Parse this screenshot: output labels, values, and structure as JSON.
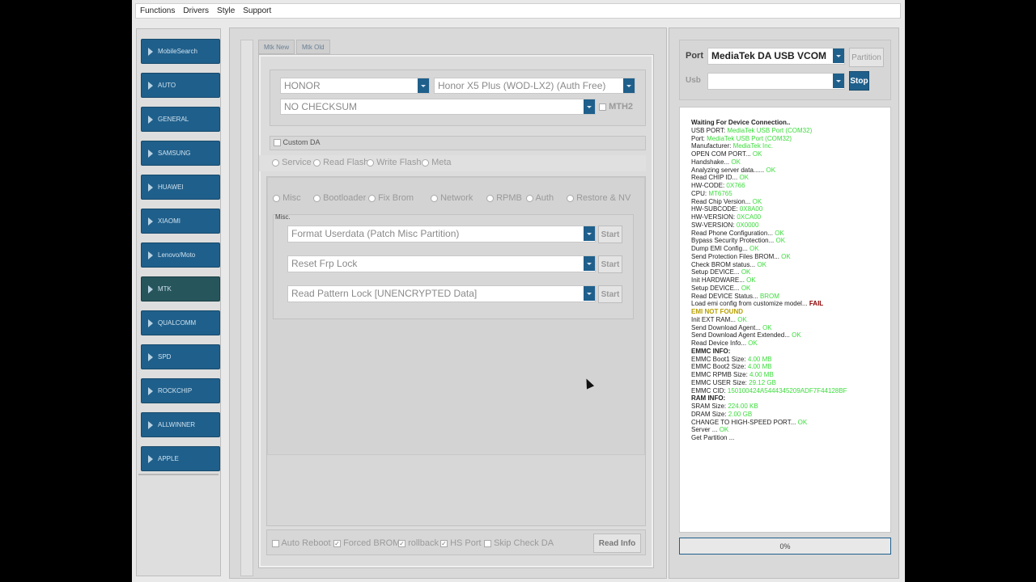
{
  "menu": [
    "Functions",
    "Drivers",
    "Style",
    "Support"
  ],
  "sidebar": {
    "items": [
      {
        "label": "MobileSearch"
      },
      {
        "label": "AUTO"
      },
      {
        "label": "GENERAL"
      },
      {
        "label": "SAMSUNG"
      },
      {
        "label": "HUAWEI"
      },
      {
        "label": "XIAOMI"
      },
      {
        "label": "Lenovo/Moto"
      },
      {
        "label": "MTK",
        "active": true
      },
      {
        "label": "QUALCOMM"
      },
      {
        "label": "SPD"
      },
      {
        "label": "ROCKCHIP"
      },
      {
        "label": "ALLWINNER"
      },
      {
        "label": "APPLE"
      }
    ]
  },
  "tabs": [
    "Mtk New",
    "Mtk Old"
  ],
  "device": {
    "brand": "HONOR",
    "model": "Honor X5 Plus (WOD-LX2) (Auth Free)",
    "checksum": "NO CHECKSUM",
    "mth2_label": "MTH2",
    "custom_da_label": "Custom DA"
  },
  "modes": [
    "Service",
    "Read Flash",
    "Write Flash",
    "Meta"
  ],
  "service_tabs": [
    "Misc",
    "Bootloader",
    "Fix Brom",
    "Network",
    "RPMB",
    "Auth",
    "Restore & NV"
  ],
  "misc": {
    "group_label": "Misc.",
    "ops": [
      {
        "label": "Format Userdata (Patch Misc Partition)",
        "button": "Start"
      },
      {
        "label": "Reset Frp Lock",
        "button": "Start"
      },
      {
        "label": "Read Pattern Lock [UNENCRYPTED Data]",
        "button": "Start"
      }
    ]
  },
  "bottom_options": [
    {
      "label": "Auto Reboot",
      "checked": false
    },
    {
      "label": "Forced BROM",
      "checked": true
    },
    {
      "label": "rollback",
      "checked": true
    },
    {
      "label": "HS Port",
      "checked": true
    },
    {
      "label": "Skip Check DA",
      "checked": false
    }
  ],
  "read_info_button": "Read Info",
  "port": {
    "label": "Port",
    "value": "MediaTek DA USB VCOM",
    "partition_button": "Partition",
    "usb_label": "Usb",
    "usb_value": "",
    "stop_button": "Stop"
  },
  "log": [
    {
      "k": "Waiting For Device Connection..",
      "v": "",
      "s": "hdr"
    },
    {
      "k": "USB PORT: ",
      "v": "MediaTek USB Port (COM32)",
      "s": "ok"
    },
    {
      "k": "Port: ",
      "v": "MediaTek USB Port (COM32)",
      "s": "ok"
    },
    {
      "k": "Manufacturer: ",
      "v": "MediaTek Inc.",
      "s": "ok"
    },
    {
      "k": "OPEN COM PORT... ",
      "v": "OK",
      "s": "ok"
    },
    {
      "k": "Handshake... ",
      "v": "OK",
      "s": "ok"
    },
    {
      "k": "Analyzing server data...... ",
      "v": "OK",
      "s": "ok"
    },
    {
      "k": "Read CHIP ID... ",
      "v": "OK",
      "s": "ok"
    },
    {
      "k": "HW-CODE: ",
      "v": "0X766",
      "s": "ok"
    },
    {
      "k": "CPU: ",
      "v": "MT6765",
      "s": "ok"
    },
    {
      "k": "Read Chip Version... ",
      "v": "OK",
      "s": "ok"
    },
    {
      "k": "HW-SUBCODE: ",
      "v": "0X8A00",
      "s": "ok"
    },
    {
      "k": "HW-VERSION: ",
      "v": "0XCA00",
      "s": "ok"
    },
    {
      "k": "SW-VERSION: ",
      "v": "0X0000",
      "s": "ok"
    },
    {
      "k": "Read Phone Configuration... ",
      "v": "OK",
      "s": "ok"
    },
    {
      "k": "Bypass Security Protection... ",
      "v": "OK",
      "s": "ok"
    },
    {
      "k": "Dump EMI Config... ",
      "v": "OK",
      "s": "ok"
    },
    {
      "k": "Send Protection Files BROM... ",
      "v": "OK",
      "s": "ok"
    },
    {
      "k": "Check BROM status... ",
      "v": "OK",
      "s": "ok"
    },
    {
      "k": "Setup DEVICE... ",
      "v": "OK",
      "s": "ok"
    },
    {
      "k": "Init HARDWARE... ",
      "v": "OK",
      "s": "ok"
    },
    {
      "k": "Setup DEVICE... ",
      "v": "OK",
      "s": "ok"
    },
    {
      "k": "Read DEVICE Status... ",
      "v": "BROM",
      "s": "ok"
    },
    {
      "k": "Load emi config from customize model... ",
      "v": "FAIL",
      "s": "fail"
    },
    {
      "k": "  EMI NOT FOUND",
      "v": "",
      "s": "warn"
    },
    {
      "k": "Init EXT RAM... ",
      "v": "OK",
      "s": "ok"
    },
    {
      "k": "Send Download Agent... ",
      "v": "OK",
      "s": "ok"
    },
    {
      "k": "Send Download Agent Extended... ",
      "v": "OK",
      "s": "ok"
    },
    {
      "k": "Read Device Info... ",
      "v": "OK",
      "s": "ok"
    },
    {
      "k": "EMMC INFO:",
      "v": "",
      "s": "hdr"
    },
    {
      "k": "EMMC Boot1 Size: ",
      "v": "4.00 MB",
      "s": "ok"
    },
    {
      "k": "EMMC Boot2 Size: ",
      "v": "4.00 MB",
      "s": "ok"
    },
    {
      "k": "EMMC RPMB Size: ",
      "v": "4.00 MB",
      "s": "ok"
    },
    {
      "k": "EMMC USER Size: ",
      "v": "29.12 GB",
      "s": "ok"
    },
    {
      "k": "EMMC CID: ",
      "v": "150100424A5444345209ADF7F44128BF",
      "s": "ok"
    },
    {
      "k": "RAM INFO:",
      "v": "",
      "s": "hdr"
    },
    {
      "k": "SRAM Size: ",
      "v": "224.00 KB",
      "s": "ok"
    },
    {
      "k": "DRAM Size: ",
      "v": "2.00 GB",
      "s": "ok"
    },
    {
      "k": "CHANGE TO HIGH-SPEED PORT... ",
      "v": "OK",
      "s": "ok"
    },
    {
      "k": "Server ... ",
      "v": "OK",
      "s": "ok"
    },
    {
      "k": "Get Partition ...",
      "v": "",
      "s": ""
    }
  ],
  "progress": {
    "label": "0%",
    "value": 0
  },
  "colors": {
    "accent": "#1f5f8b",
    "ok": "#3cdc3c",
    "fail": "#8b0000"
  }
}
